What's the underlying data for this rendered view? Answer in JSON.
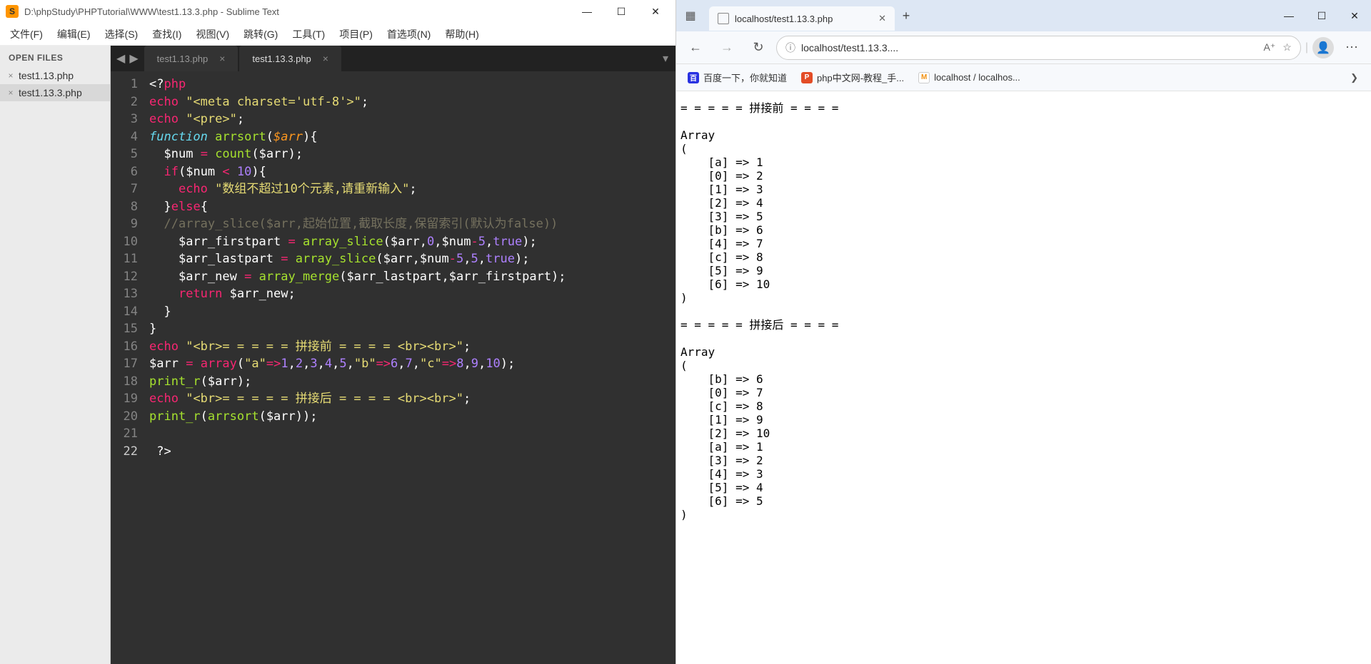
{
  "sublime": {
    "title": "D:\\phpStudy\\PHPTutorial\\WWW\\test1.13.3.php - Sublime Text",
    "menu": [
      "文件(F)",
      "编辑(E)",
      "选择(S)",
      "查找(I)",
      "视图(V)",
      "跳转(G)",
      "工具(T)",
      "项目(P)",
      "首选项(N)",
      "帮助(H)"
    ],
    "open_files_label": "OPEN FILES",
    "open_files": [
      {
        "name": "test1.13.php",
        "active": false
      },
      {
        "name": "test1.13.3.php",
        "active": true
      }
    ],
    "tabs": [
      {
        "name": "test1.13.php",
        "active": false
      },
      {
        "name": "test1.13.3.php",
        "active": true
      }
    ],
    "line_count": 22
  },
  "browser": {
    "tab_title": "localhost/test1.13.3.php",
    "address": "localhost/test1.13.3....",
    "bookmarks": [
      {
        "icon": "baidu",
        "label": "百度一下，你就知道"
      },
      {
        "icon": "php",
        "label": "php中文网-教程_手..."
      },
      {
        "icon": "pma",
        "label": "localhost / localhos..."
      }
    ],
    "output": "= = = = = 拼接前 = = = = \n\nArray\n(\n    [a] => 1\n    [0] => 2\n    [1] => 3\n    [2] => 4\n    [3] => 5\n    [b] => 6\n    [4] => 7\n    [c] => 8\n    [5] => 9\n    [6] => 10\n)\n\n= = = = = 拼接后 = = = = \n\nArray\n(\n    [b] => 6\n    [0] => 7\n    [c] => 8\n    [1] => 9\n    [2] => 10\n    [a] => 1\n    [3] => 2\n    [4] => 3\n    [5] => 4\n    [6] => 5\n)"
  }
}
